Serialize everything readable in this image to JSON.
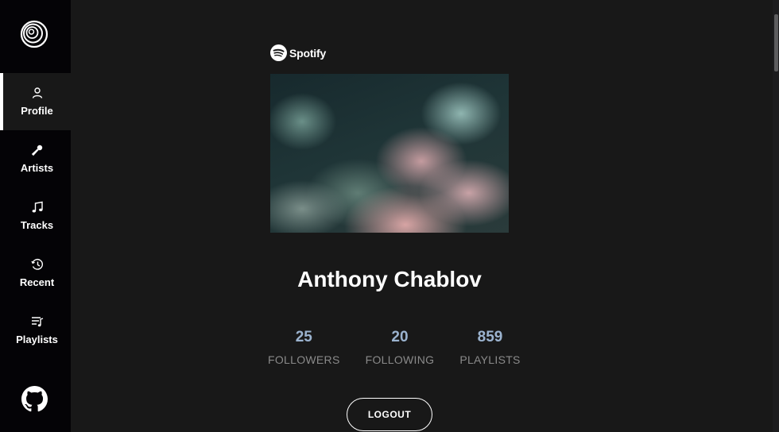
{
  "brand": {
    "logo_icon": "spotify-circle-logo",
    "spotify_word": "Spotify"
  },
  "sidebar": {
    "items": [
      {
        "label": "Profile",
        "icon": "user-icon",
        "active": true
      },
      {
        "label": "Artists",
        "icon": "microphone-icon",
        "active": false
      },
      {
        "label": "Tracks",
        "icon": "music-note-icon",
        "active": false
      },
      {
        "label": "Recent",
        "icon": "clock-icon",
        "active": false
      },
      {
        "label": "Playlists",
        "icon": "playlist-icon",
        "active": false
      }
    ],
    "footer_icon": "github-icon"
  },
  "profile": {
    "name": "Anthony Chablov",
    "stats": [
      {
        "value": "25",
        "label": "FOLLOWERS"
      },
      {
        "value": "20",
        "label": "FOLLOWING"
      },
      {
        "value": "859",
        "label": "PLAYLISTS"
      }
    ],
    "logout_label": "LOGOUT"
  },
  "colors": {
    "sidebar_bg": "#040306",
    "main_bg": "#181818",
    "stat_value": "#9bb3cf",
    "stat_label": "#8a8a8a"
  }
}
